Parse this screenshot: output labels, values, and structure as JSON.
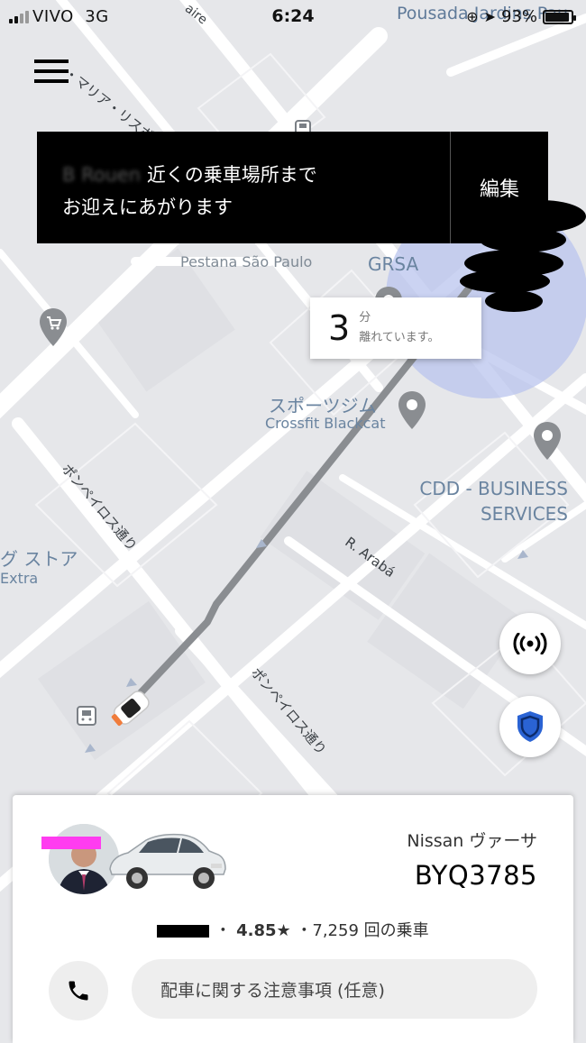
{
  "status_bar": {
    "carrier": "VIVO",
    "network": "3G",
    "time": "6:24",
    "battery": "93%"
  },
  "banner": {
    "location_redacted": "B    Rouen",
    "line1": "近くの乗車場所まで",
    "line2": "お迎えにあがります",
    "edit_label": "編集"
  },
  "eta": {
    "minutes": "3",
    "unit": "分",
    "suffix": "離れています。"
  },
  "map": {
    "labels": {
      "pousada": "Pousada Jardins Pau",
      "street_top": "・マリア・リスボン通",
      "pestana": "Pestana São Paulo",
      "grsa": "GRSA",
      "gym_jp": "スポーツジム",
      "gym_en": "Crossfit Blackcat",
      "cdd_1": "CDD - BUSINESS",
      "cdd_2": "SERVICES",
      "store_jp": "グ ストア",
      "store_en": "Extra",
      "pompeia_1": "ポンペイロス通り",
      "pompeia_2": "ポンペイロス通り",
      "araba": "R. Arabá",
      "aire": "aire"
    }
  },
  "driver_card": {
    "vehicle_model": "Nissan ヴァーサ",
    "plate": "BYQ3785",
    "rating": "4.85★",
    "separator": "・",
    "trips": "7,259 回の乗車",
    "note_placeholder": "配車に関する注意事項 (任意)"
  },
  "colors": {
    "banner_bg": "#000000",
    "route": "#8a8d91",
    "pickup_zone": "#b9c4ee",
    "shield": "#2a63d4",
    "map_bg": "#e6e7ea"
  }
}
